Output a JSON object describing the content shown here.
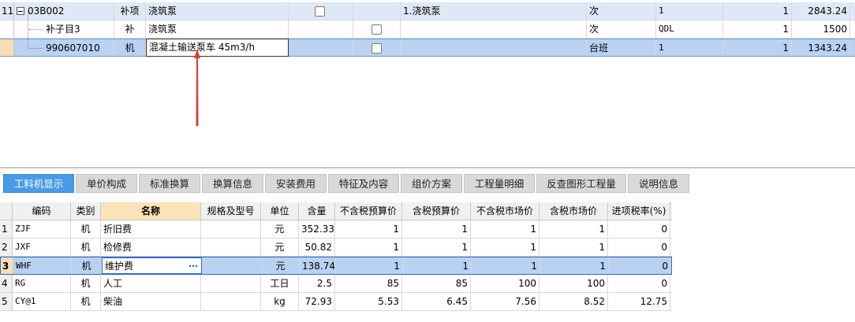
{
  "top_grid": {
    "rows": [
      {
        "num": "11",
        "code": "03B002",
        "type": "补项",
        "name": "浇筑泵",
        "feature": "1.浇筑泵",
        "unit": "次",
        "expr": "1",
        "qty": "1",
        "price": "2843.24"
      },
      {
        "num": "",
        "code": "补子目3",
        "type": "补",
        "name": "浇筑泵",
        "feature": "",
        "unit": "次",
        "expr": "QDL",
        "qty": "1",
        "price": "1500"
      },
      {
        "num": "",
        "code": "990607010",
        "type": "机",
        "name": "混凝土输送泵车 45m3/h",
        "feature": "",
        "unit": "台班",
        "expr": "1",
        "qty": "1",
        "price": "1343.24"
      }
    ]
  },
  "tabs": [
    {
      "label": "工料机显示",
      "active": true
    },
    {
      "label": "单价构成"
    },
    {
      "label": "标准换算"
    },
    {
      "label": "换算信息"
    },
    {
      "label": "安装费用"
    },
    {
      "label": "特征及内容"
    },
    {
      "label": "组价方案"
    },
    {
      "label": "工程量明细"
    },
    {
      "label": "反查图形工程量"
    },
    {
      "label": "说明信息"
    }
  ],
  "resource_table": {
    "headers": {
      "code": "编码",
      "type": "类别",
      "name": "名称",
      "spec": "规格及型号",
      "unit": "单位",
      "qty": "含量",
      "p1": "不含税预算价",
      "p2": "含税预算价",
      "p3": "不含税市场价",
      "p4": "含税市场价",
      "tax": "进项税率(%)"
    },
    "rows": [
      {
        "num": "1",
        "code": "ZJF",
        "type": "机",
        "name": "折旧费",
        "spec": "",
        "unit": "元",
        "qty": "352.33",
        "p1": "1",
        "p2": "1",
        "p3": "1",
        "p4": "1",
        "tax": "0"
      },
      {
        "num": "2",
        "code": "JXF",
        "type": "机",
        "name": "检修费",
        "spec": "",
        "unit": "元",
        "qty": "50.82",
        "p1": "1",
        "p2": "1",
        "p3": "1",
        "p4": "1",
        "tax": "0"
      },
      {
        "num": "3",
        "code": "WHF",
        "type": "机",
        "name": "维护费",
        "spec": "",
        "unit": "元",
        "qty": "138.74",
        "p1": "1",
        "p2": "1",
        "p3": "1",
        "p4": "1",
        "tax": "0"
      },
      {
        "num": "4",
        "code": "RG",
        "type": "机",
        "name": "人工",
        "spec": "",
        "unit": "工日",
        "qty": "2.5",
        "p1": "85",
        "p2": "85",
        "p3": "100",
        "p4": "100",
        "tax": "0"
      },
      {
        "num": "5",
        "code": "CY@1",
        "type": "机",
        "name": "柴油",
        "spec": "",
        "unit": "kg",
        "qty": "72.93",
        "p1": "5.53",
        "p2": "6.45",
        "p3": "7.56",
        "p4": "8.52",
        "tax": "12.75"
      }
    ]
  },
  "icons": {
    "expand": "collapse-minus-icon",
    "checkbox": "checkbox-icon",
    "ellipsis": "more-options-icon",
    "arrow": "annotation-arrow"
  },
  "colors": {
    "tab_active": "#4a9be6",
    "row_selected": "#b9d2f1",
    "header_highlight": "#fbe3b8",
    "arrow": "#e53935"
  }
}
